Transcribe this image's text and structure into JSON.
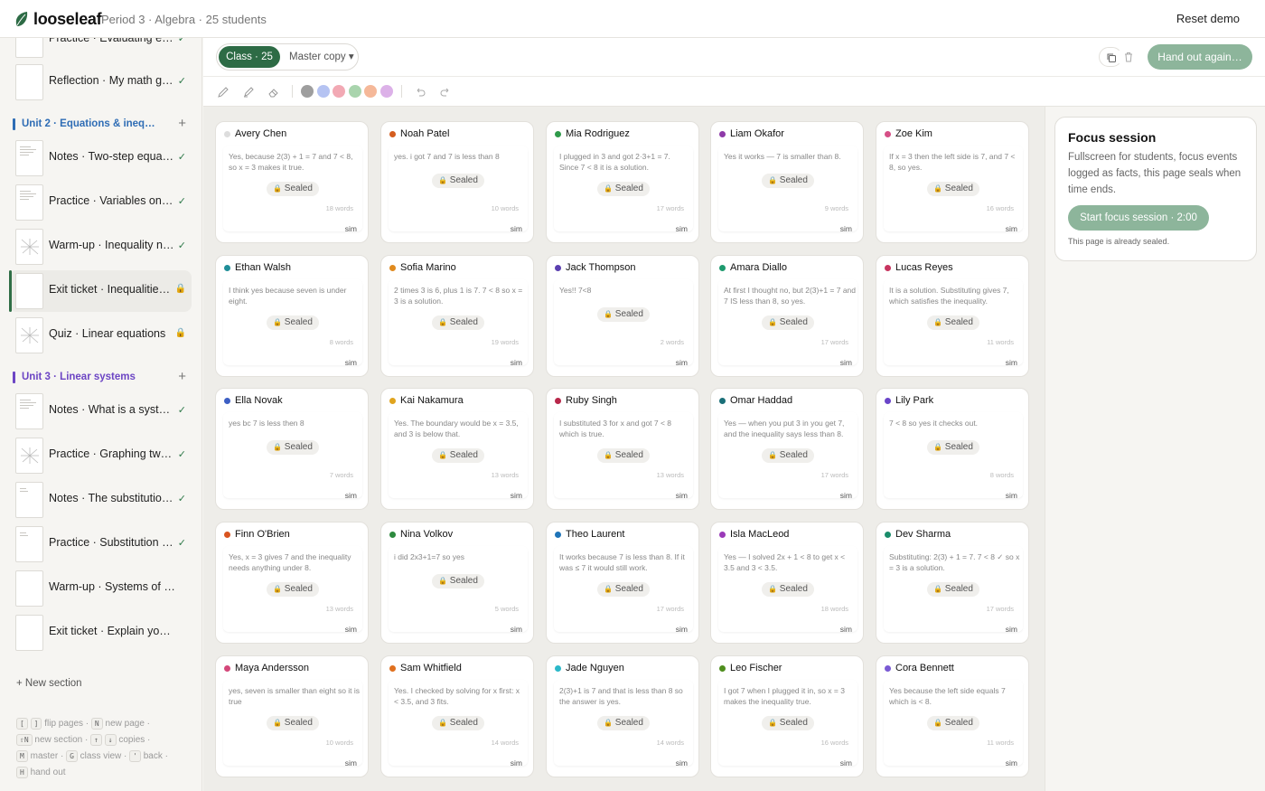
{
  "app": {
    "name": "looseleaf",
    "context": "Period 3 · Algebra · 25 students",
    "reset_label": "Reset demo"
  },
  "sidebar": {
    "pages_top": [
      {
        "title": "Practice · Evaluating ex…",
        "status": "✓"
      },
      {
        "title": "Reflection · My math goals",
        "status": "✓"
      }
    ],
    "unit2": {
      "title": "Unit 2 · Equations & ineq…",
      "color": "#2f6db5",
      "pages": [
        {
          "title": "Notes · Two-step equati…",
          "status": "✓"
        },
        {
          "title": "Practice · Variables on b…",
          "status": "✓"
        },
        {
          "title": "Warm-up · Inequality nu…",
          "status": "✓"
        },
        {
          "title": "Exit ticket · Inequalities …",
          "status": "🔒"
        },
        {
          "title": "Quiz · Linear equations",
          "status": "🔒"
        }
      ]
    },
    "unit3": {
      "title": "Unit 3 · Linear systems",
      "color": "#6c45c4",
      "pages": [
        {
          "title": "Notes · What is a system?",
          "status": "✓"
        },
        {
          "title": "Practice · Graphing two l…",
          "status": "✓"
        },
        {
          "title": "Notes · The substitution …",
          "status": "✓"
        },
        {
          "title": "Practice · Substitution dr…",
          "status": "✓"
        },
        {
          "title": "Warm-up · Systems of eq…",
          "status": ""
        },
        {
          "title": "Exit ticket · Explain your r…",
          "status": ""
        }
      ]
    },
    "new_section_label": "+ New section",
    "shortcuts": {
      "k_flip1": "[",
      "k_flip2": "]",
      "flip": "flip pages ·",
      "k_new": "N",
      "new_page": "new page ·",
      "k_section": "⇧N",
      "new_section": "new section ·",
      "k_up": "↑",
      "k_down": "↓",
      "copies": "copies ·",
      "k_master": "M",
      "master": "master ·",
      "k_class": "G",
      "class_view": "class view ·",
      "k_back": "'",
      "back": "back ·",
      "k_hand": "H",
      "hand_out": "hand out"
    }
  },
  "toolbar": {
    "class_label": "Class · 25",
    "master_label": "Master copy ▾",
    "handout_label": "Hand out again…"
  },
  "drawing": {
    "colors": [
      "#9e9e9e",
      "#b5c3f2",
      "#f2a9b4",
      "#a9d4ad",
      "#f5b899",
      "#dcb1e8"
    ]
  },
  "cards": [
    {
      "name": "Avery Chen",
      "color": "#dddddd",
      "answer": "Yes, because 2(3) + 1 = 7 and 7 < 8, so x = 3 makes it true.",
      "seal": "Sealed",
      "words": "18 words",
      "sim": "sim"
    },
    {
      "name": "Noah Patel",
      "color": "#d45d1f",
      "answer": "yes. i got 7 and 7 is less than 8",
      "seal": "Sealed",
      "words": "10 words",
      "sim": "sim"
    },
    {
      "name": "Mia Rodriguez",
      "color": "#2f9a4a",
      "answer": "I plugged in 3 and got 2·3+1 = 7. Since 7 < 8 it is a solution.",
      "seal": "Sealed",
      "words": "17 words",
      "sim": "sim"
    },
    {
      "name": "Liam Okafor",
      "color": "#8e3aa8",
      "answer": "Yes it works — 7 is smaller than 8.",
      "seal": "Sealed",
      "words": "9 words",
      "sim": "sim"
    },
    {
      "name": "Zoe Kim",
      "color": "#d64f86",
      "answer": "If x = 3 then the left side is 7, and 7 < 8, so yes.",
      "seal": "Sealed",
      "words": "16 words",
      "sim": "sim"
    },
    {
      "name": "Ethan Walsh",
      "color": "#1f8e98",
      "answer": "I think yes because seven is under eight.",
      "seal": "Sealed",
      "words": "8 words",
      "sim": "sim"
    },
    {
      "name": "Sofia Marino",
      "color": "#e08a1e",
      "answer": "2 times 3 is 6, plus 1 is 7. 7 < 8 so x = 3 is a solution.",
      "seal": "Sealed",
      "words": "19 words",
      "sim": "sim"
    },
    {
      "name": "Jack Thompson",
      "color": "#5b3fb0",
      "answer": "Yes!! 7<8",
      "seal": "Sealed",
      "words": "2 words",
      "sim": "sim"
    },
    {
      "name": "Amara Diallo",
      "color": "#1e9a6e",
      "answer": "At first I thought no, but 2(3)+1 = 7 and 7 IS less than 8, so yes.",
      "seal": "Sealed",
      "words": "17 words",
      "sim": "sim"
    },
    {
      "name": "Lucas Reyes",
      "color": "#c7345f",
      "answer": "It is a solution. Substituting gives 7, which satisfies the inequality.",
      "seal": "Sealed",
      "words": "11 words",
      "sim": "sim"
    },
    {
      "name": "Ella Novak",
      "color": "#3d5fc4",
      "answer": "yes bc 7 is less then 8",
      "seal": "Sealed",
      "words": "7 words",
      "sim": "sim"
    },
    {
      "name": "Kai Nakamura",
      "color": "#e0a41e",
      "answer": "Yes. The boundary would be x = 3.5, and 3 is below that.",
      "seal": "Sealed",
      "words": "13 words",
      "sim": "sim"
    },
    {
      "name": "Ruby Singh",
      "color": "#b8284a",
      "answer": "I substituted 3 for x and got 7 < 8 which is true.",
      "seal": "Sealed",
      "words": "13 words",
      "sim": "sim"
    },
    {
      "name": "Omar Haddad",
      "color": "#1a6f78",
      "answer": "Yes — when you put 3 in you get 7, and the inequality says less than 8.",
      "seal": "Sealed",
      "words": "17 words",
      "sim": "sim"
    },
    {
      "name": "Lily Park",
      "color": "#6a45c9",
      "answer": "7 < 8 so yes it checks out.",
      "seal": "Sealed",
      "words": "8 words",
      "sim": "sim"
    },
    {
      "name": "Finn O'Brien",
      "color": "#d9541f",
      "answer": "Yes, x = 3 gives 7 and the inequality needs anything under 8.",
      "seal": "Sealed",
      "words": "13 words",
      "sim": "sim"
    },
    {
      "name": "Nina Volkov",
      "color": "#2d8a3e",
      "answer": "i did 2x3+1=7 so yes",
      "seal": "Sealed",
      "words": "5 words",
      "sim": "sim"
    },
    {
      "name": "Theo Laurent",
      "color": "#1f74b8",
      "answer": "It works because 7 is less than 8. If it was ≤ 7 it would still work.",
      "seal": "Sealed",
      "words": "17 words",
      "sim": "sim"
    },
    {
      "name": "Isla MacLeod",
      "color": "#9a3ab8",
      "answer": "Yes — I solved 2x + 1 < 8 to get x < 3.5 and 3 < 3.5.",
      "seal": "Sealed",
      "words": "18 words",
      "sim": "sim"
    },
    {
      "name": "Dev Sharma",
      "color": "#1a8c6a",
      "answer": "Substituting: 2(3) + 1 = 7. 7 < 8 ✓ so x = 3 is a solution.",
      "seal": "Sealed",
      "words": "17 words",
      "sim": "sim"
    },
    {
      "name": "Maya Andersson",
      "color": "#d4487a",
      "answer": "yes, seven is smaller than eight so it is true",
      "seal": "Sealed",
      "words": "10 words",
      "sim": "sim"
    },
    {
      "name": "Sam Whitfield",
      "color": "#e0701e",
      "answer": "Yes. I checked by solving for x first: x < 3.5, and 3 fits.",
      "seal": "Sealed",
      "words": "14 words",
      "sim": "sim"
    },
    {
      "name": "Jade Nguyen",
      "color": "#2bb8c9",
      "answer": "2(3)+1 is 7 and that is less than 8 so the answer is yes.",
      "seal": "Sealed",
      "words": "14 words",
      "sim": "sim"
    },
    {
      "name": "Leo Fischer",
      "color": "#4f8e1e",
      "answer": "I got 7 when I plugged it in, so x = 3 makes the inequality true.",
      "seal": "Sealed",
      "words": "16 words",
      "sim": "sim"
    },
    {
      "name": "Cora Bennett",
      "color": "#7a5ad4",
      "answer": "Yes because the left side equals 7 which is < 8.",
      "seal": "Sealed",
      "words": "11 words",
      "sim": "sim"
    }
  ],
  "focus": {
    "title": "Focus session",
    "description": "Fullscreen for students, focus events logged as facts, this page seals when time ends.",
    "button_label": "Start focus session · 2:00",
    "note": "This page is already sealed."
  }
}
